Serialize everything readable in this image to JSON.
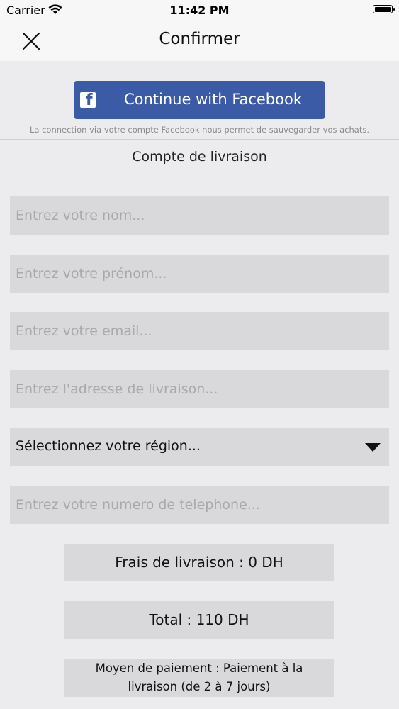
{
  "status_bar": {
    "carrier": "Carrier",
    "time": "11:42 PM",
    "wifi_icon": "wifi-icon",
    "battery_icon": "battery-icon"
  },
  "nav": {
    "title": "Confirmer",
    "close_icon": "close-icon"
  },
  "facebook": {
    "button_label": "Continue with Facebook",
    "icon": "facebook-icon",
    "icon_glyph": "f",
    "brand_color": "#3b5ba6",
    "note": "La connection via votre compte Facebook nous permet de sauvegarder vos achats."
  },
  "form": {
    "section_title": "Compte de livraison",
    "last_name_placeholder": "Entrez votre nom...",
    "first_name_placeholder": "Entrez votre prénom...",
    "email_placeholder": "Entrez votre email...",
    "address_placeholder": "Entrez l'adresse de livraison...",
    "region_label": "Sélectionnez votre région...",
    "phone_placeholder": "Entrez votre numero de telephone..."
  },
  "summary": {
    "delivery_fee": "Frais de livraison : 0 DH",
    "total": "Total : 110 DH",
    "payment_line1": "Moyen de paiement : Paiement à la",
    "payment_line2": "livraison (de 2 à 7 jours)"
  }
}
